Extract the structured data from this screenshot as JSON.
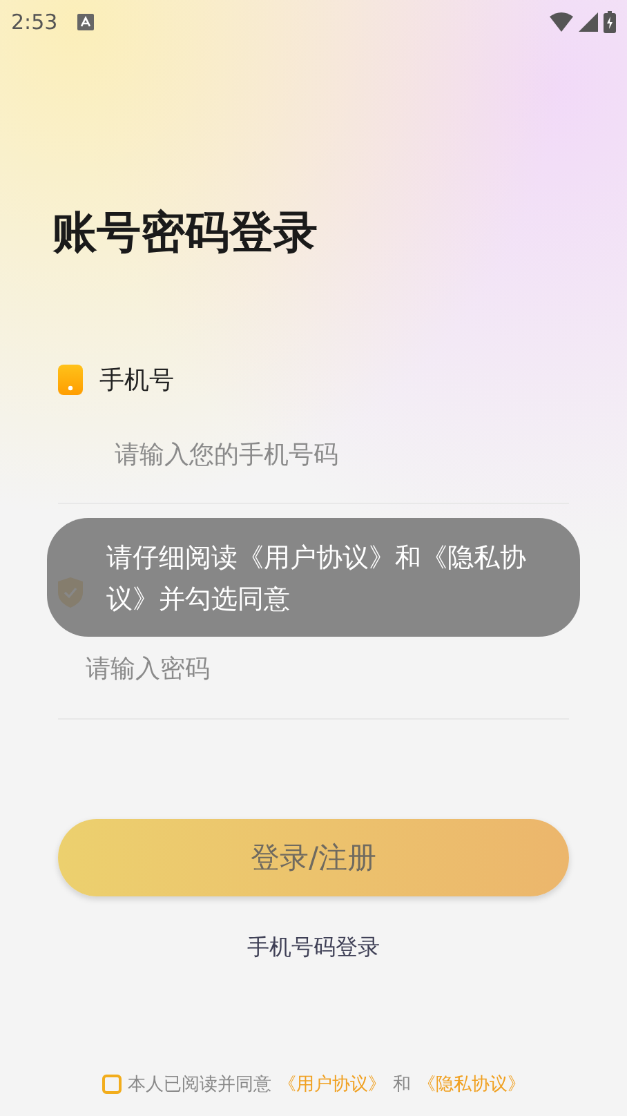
{
  "status_bar": {
    "time": "2:53"
  },
  "title": "账号密码登录",
  "phone_field": {
    "label": "手机号",
    "placeholder": "请输入您的手机号码"
  },
  "password_field": {
    "placeholder": "请输入密码"
  },
  "login_button": "登录/注册",
  "alt_login_link": "手机号码登录",
  "agreement": {
    "checked": false,
    "prefix": "本人已阅读并同意",
    "user_agreement": "《用户协议》",
    "conjunction": "和",
    "privacy_agreement": "《隐私协议》"
  },
  "toast": "请仔细阅读《用户协议》和《隐私协议》并勾选同意"
}
